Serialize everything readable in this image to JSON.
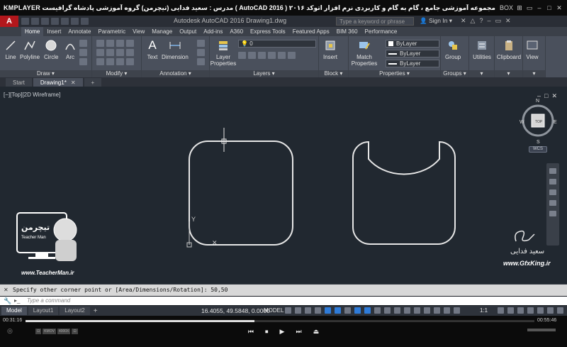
{
  "player": {
    "brand": "KMPLAYER",
    "title": "مجموعه آموزشی جامع ، گام به گام و کاربردی نرم افزار  اتوکد ۲۰۱۶ ( AutoCAD  2016 )  مدرس : سعید فدایی (تیچرمن) گروه آموزشی پادشاه گرافیست ها",
    "window_buttons": [
      "BOX",
      "⊞",
      "▭",
      "–",
      "□",
      "✕"
    ],
    "time_elapsed": "00:31:16",
    "time_total": "00:55:46",
    "progress_fraction": 0.45,
    "controls": [
      "⏮",
      "⏹",
      "▶",
      "⏭",
      "⏏"
    ],
    "mini_labels": [
      "⊡",
      "KMOV",
      "4000X",
      "⊡"
    ]
  },
  "acad": {
    "logo": "A",
    "app_title": "Autodesk AutoCAD 2016    Drawing1.dwg",
    "search_placeholder": "Type a keyword or phrase",
    "sign_in": "Sign In",
    "tabs": [
      "Home",
      "Insert",
      "Annotate",
      "Parametric",
      "View",
      "Manage",
      "Output",
      "Add-ins",
      "A360",
      "Express Tools",
      "Featured Apps",
      "BIM 360",
      "Performance"
    ],
    "active_tab": "Home"
  },
  "ribbon": {
    "draw": {
      "title": "Draw",
      "tools": [
        "Line",
        "Polyline",
        "Circle",
        "Arc"
      ]
    },
    "modify": {
      "title": "Modify"
    },
    "annotation": {
      "title": "Annotation",
      "tools": [
        "Text",
        "Dimension"
      ]
    },
    "layers": {
      "title": "Layers",
      "tool": "Layer\nProperties",
      "layer_value": "0"
    },
    "block": {
      "title": "Block",
      "tool": "Insert"
    },
    "properties": {
      "title": "Properties",
      "tool": "Match\nProperties",
      "bylayer": [
        "ByLayer",
        "ByLayer",
        "ByLayer"
      ]
    },
    "groups": {
      "title": "Groups",
      "tool": "Group"
    },
    "utilities": {
      "tool": "Utilities"
    },
    "clipboard": {
      "tool": "Clipboard"
    },
    "view": {
      "tool": "View"
    }
  },
  "doc_tabs": [
    "Start",
    "Drawing1*",
    "+"
  ],
  "viewport": {
    "label": "[−][Top][2D Wireframe]",
    "compass": {
      "n": "N",
      "s": "S",
      "e": "E",
      "w": "W",
      "center": "TOP"
    },
    "wcs": "WCS",
    "ucs_y": "Y"
  },
  "watermarks": {
    "left_url": "www.TeacherMan.ir",
    "left_logo_text": "تیچرمن",
    "left_logo_sub": "Teacher Man",
    "right_sig": "سعید فدایی",
    "right_url": "www.GfxKing.ir"
  },
  "command": {
    "history": "Specify other corner point or [Area/Dimensions/Rotation]: 50,50",
    "placeholder": "Type a command"
  },
  "status": {
    "layout_tabs": [
      "Model",
      "Layout1",
      "Layout2"
    ],
    "add": "+",
    "coords": "16.4055, 49.5848, 0.0000",
    "mode": "MODEL",
    "scale": "1:1"
  },
  "colors": {
    "canvas": "#212830",
    "ribbon": "#4a505c",
    "acad_red": "#b3171c",
    "geometry": "#e6e6e6"
  }
}
